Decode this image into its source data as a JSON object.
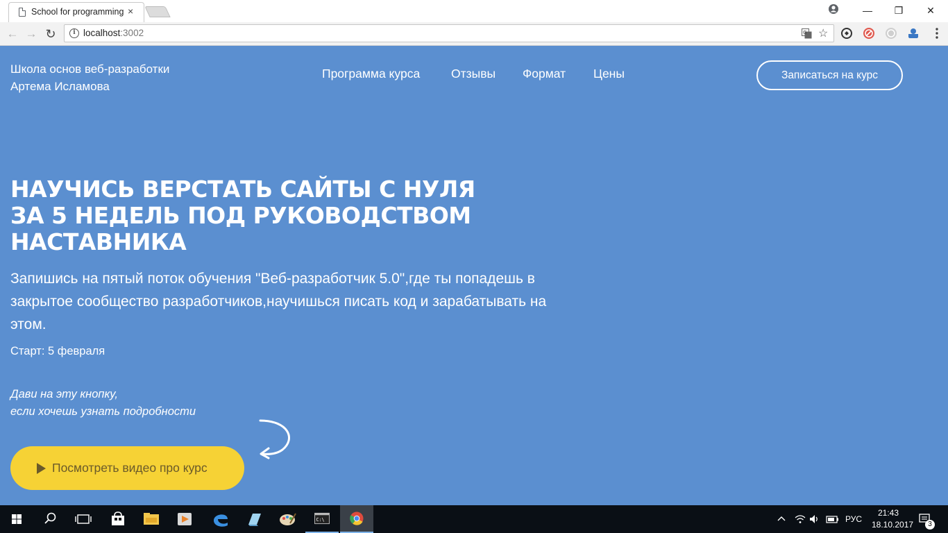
{
  "browser": {
    "tab_title": "School for programming",
    "tab_close": "×",
    "url_host": "localhost",
    "url_port": ":3002",
    "back": "←",
    "forward": "→",
    "reload": "↻",
    "star": "☆",
    "win_minimize": "—",
    "win_restore": "❐",
    "win_close": "✕"
  },
  "page": {
    "brand_line1": "Школа основ веб-разработки",
    "brand_line2": "Артема Исламова",
    "nav": {
      "item1": "Программа курса",
      "item2": "Отзывы",
      "item3": "Формат",
      "item4": "Цены"
    },
    "signup_button": "Записаться на курс",
    "hero_line1": "Научись верстать сайты с нуля",
    "hero_line2": "за 5 недель под руководством",
    "hero_line3": "наставника",
    "subtitle": "Запишись на пятый поток обучения \"Веб-разработчик 5.0\",где ты попадешь в закрытое сообщество разработчиков,научишься писать код и зарабатывать на этом.",
    "start": "Старт: 5 февраля",
    "hint_line1": "Дави на эту кнопку,",
    "hint_line2": "если хочешь узнать подробности",
    "video_button": "Посмотреть видео про курс"
  },
  "taskbar": {
    "language": "РУС",
    "time": "21:43",
    "date": "18.10.2017",
    "notifications": "3"
  },
  "colors": {
    "page_background": "#5b8fd0",
    "video_button": "#f6d235",
    "taskbar": "#0a0f15"
  }
}
